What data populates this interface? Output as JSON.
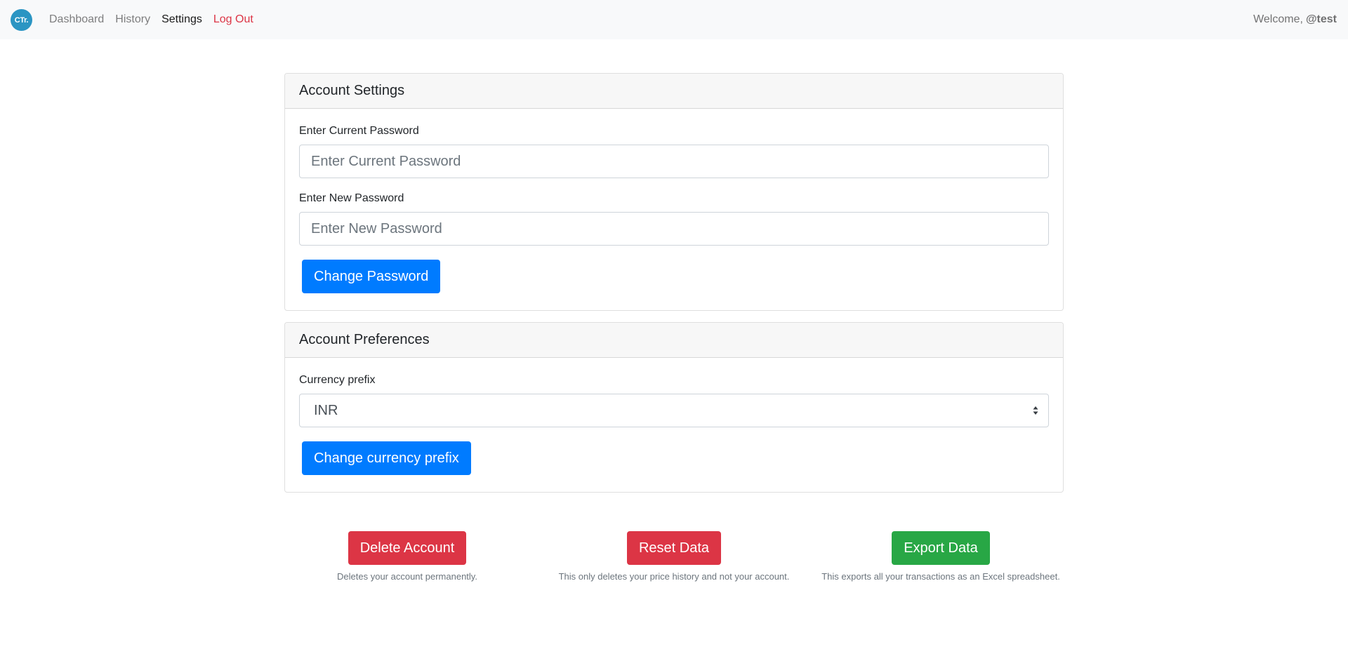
{
  "navbar": {
    "brand": "CTr.",
    "links": [
      {
        "label": "Dashboard"
      },
      {
        "label": "History"
      },
      {
        "label": "Settings"
      },
      {
        "label": "Log Out"
      }
    ],
    "welcome_prefix": "Welcome,",
    "username": "@test"
  },
  "account_settings": {
    "title": "Account Settings",
    "current_password_label": "Enter Current Password",
    "current_password_placeholder": "Enter Current Password",
    "new_password_label": "Enter New Password",
    "new_password_placeholder": "Enter New Password",
    "change_password_button": "Change Password"
  },
  "account_preferences": {
    "title": "Account Preferences",
    "currency_label": "Currency prefix",
    "currency_value": "INR",
    "change_currency_button": "Change currency prefix"
  },
  "actions": {
    "delete": {
      "label": "Delete Account",
      "help": "Deletes your account permanently."
    },
    "reset": {
      "label": "Reset Data",
      "help": "This only deletes your price history and not your account."
    },
    "export": {
      "label": "Export Data",
      "help": "This exports all your transactions as an Excel spreadsheet."
    }
  },
  "colors": {
    "primary": "#007bff",
    "danger": "#dc3545",
    "success": "#28a745",
    "brand": "#2b95c3"
  }
}
